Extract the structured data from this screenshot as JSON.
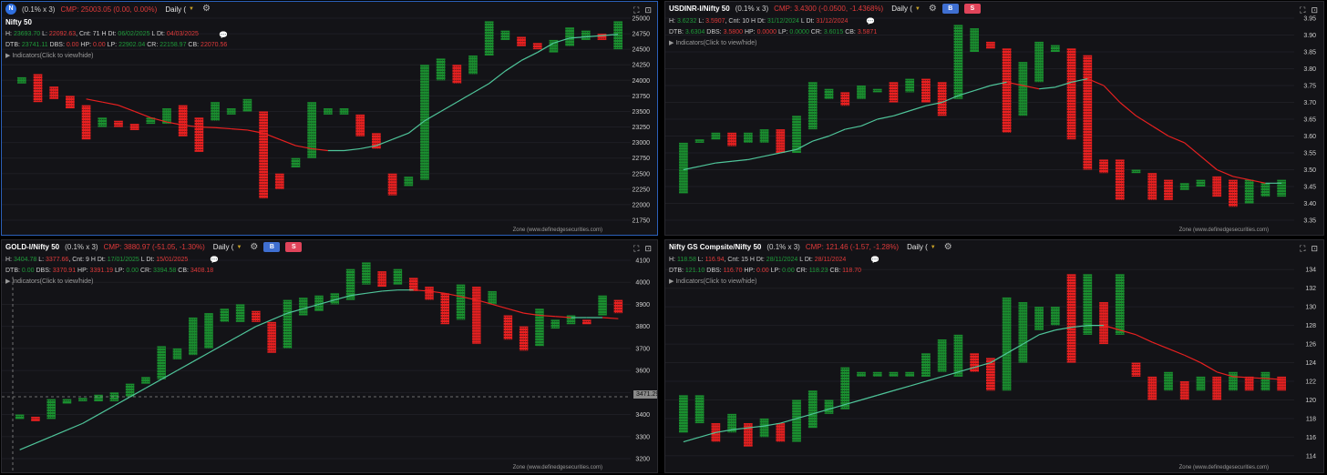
{
  "colors": {
    "bull": "#1a8f2f",
    "bear": "#e82020",
    "ma_up": "#4fc59a",
    "ma_down": "#e82020",
    "bg": "#131317",
    "grid": "#1e1e24",
    "axis_text": "#cfcfcf"
  },
  "panels": [
    {
      "header": {
        "badge": "N",
        "multiplier": "(0.1% x 3)",
        "cmp": "CMP: 25003.05 (0.00, 0.00%)",
        "timeframe": "Daily (",
        "settings_icon": "gear-icon"
      },
      "sub_title": "Nifty 50",
      "line1": {
        "h_label": "H:",
        "h_val": "23693.70",
        "l_label": "L:",
        "l_val": "22092.63",
        "cnt": ", Cnt: 71 H Dt:",
        "hdt": "06/02/2025",
        "ldt_label": "L Dt:",
        "ldt": "04/03/2025"
      },
      "line2": {
        "dtb_label": "DTB:",
        "dtb": "23741.11",
        "dbs_label": "DBS:",
        "dbs": "0.00",
        "hp_label": "HP:",
        "hp": "0.00",
        "lp_label": "LP:",
        "lp": "22902.04",
        "cr_label": "CR:",
        "cr": "22158.97",
        "cb_label": "CB:",
        "cb": "22070.56"
      },
      "indicators": "Indicators(Click to view/hide)",
      "zone": "Zone (www.definedgesecurities.com)"
    },
    {
      "header": {
        "title": "USDINR-I/Nifty 50",
        "multiplier": "(0.1% x 3)",
        "cmp": "CMP: 3.4300 (-0.0500, -1.4368%)",
        "timeframe": "Daily (",
        "buy": "B",
        "sell": "S"
      },
      "line1": {
        "h_label": "H:",
        "h_val": "3.6232",
        "l_label": "L:",
        "l_val": "3.5907",
        "cnt": ", Cnt: 10 H Dt:",
        "hdt": "31/12/2024",
        "ldt_label": "L Dt:",
        "ldt": "31/12/2024"
      },
      "line2": {
        "dtb_label": "DTB:",
        "dtb": "3.6304",
        "dbs_label": "DBS:",
        "dbs": "3.5800",
        "hp_label": "HP:",
        "hp": "0.0000",
        "lp_label": "LP:",
        "lp": "0.0000",
        "cr_label": "CR:",
        "cr": "3.6015",
        "cb_label": "CB:",
        "cb": "3.5871"
      },
      "indicators": "Indicators(Click to view/hide)",
      "zone": "Zone (www.definedgesecurities.com)"
    },
    {
      "header": {
        "title": "GOLD-I/Nifty 50",
        "multiplier": "(0.1% x 3)",
        "cmp": "CMP: 3880.97 (-51.05, -1.30%)",
        "timeframe": "Daily (",
        "buy": "B",
        "sell": "S"
      },
      "line1": {
        "h_label": "H:",
        "h_val": "3404.78",
        "l_label": "L:",
        "l_val": "3377.66",
        "cnt": ", Cnt: 9 H Dt:",
        "hdt": "17/01/2025",
        "ldt_label": "L Dt:",
        "ldt": "15/01/2025"
      },
      "line2": {
        "dtb_label": "DTB:",
        "dtb": "0.00",
        "dbs_label": "DBS:",
        "dbs": "3370.91",
        "hp_label": "HP:",
        "hp": "3391.19",
        "lp_label": "LP:",
        "lp": "0.00",
        "cr_label": "CR:",
        "cr": "3394.58",
        "cb_label": "CB:",
        "cb": "3408.18"
      },
      "indicators": "Indicators(Click to view/hide)",
      "zone": "Zone (www.definedgesecurities.com)",
      "cross_value": "3471.29"
    },
    {
      "header": {
        "title": "Nifty GS Compsite/Nifty 50",
        "multiplier": "(0.1% x 3)",
        "cmp": "CMP: 121.46 (-1.57, -1.28%)",
        "timeframe": "Daily ("
      },
      "line1": {
        "h_label": "H:",
        "h_val": "118.58",
        "l_label": "L:",
        "l_val": "116.94",
        "cnt": ", Cnt: 15 H Dt:",
        "hdt": "28/11/2024",
        "ldt_label": "L Dt:",
        "ldt": "28/11/2024"
      },
      "line2": {
        "dtb_label": "DTB:",
        "dtb": "121.10",
        "dbs_label": "DBS:",
        "dbs": "116.70",
        "hp_label": "HP:",
        "hp": "0.00",
        "lp_label": "LP:",
        "lp": "0.00",
        "cr_label": "CR:",
        "cr": "118.23",
        "cb_label": "CB:",
        "cb": "118.70"
      },
      "indicators": "Indicators(Click to view/hide)",
      "zone": "Zone (www.definedgesecurities.com)"
    }
  ],
  "chart_data": [
    {
      "type": "bar",
      "title": "Nifty 50",
      "ylim": [
        21750,
        25000
      ],
      "yticks": [
        21750,
        22000,
        22250,
        22500,
        22750,
        23000,
        23250,
        23500,
        23750,
        24000,
        24250,
        24500,
        24750,
        25000
      ],
      "bars": [
        [
          24050,
          23950
        ],
        [
          24100,
          23650
        ],
        [
          23900,
          23700
        ],
        [
          23750,
          23550
        ],
        [
          23600,
          23050
        ],
        [
          23400,
          23250
        ],
        [
          23350,
          23250
        ],
        [
          23300,
          23200
        ],
        [
          23400,
          23300
        ],
        [
          23550,
          23300
        ],
        [
          23600,
          23100
        ],
        [
          23400,
          22850
        ],
        [
          23650,
          23350
        ],
        [
          23550,
          23450
        ],
        [
          23700,
          23500
        ],
        [
          23500,
          22100
        ],
        [
          22500,
          22250
        ],
        [
          22750,
          22600
        ],
        [
          23650,
          22750
        ],
        [
          23550,
          23450
        ],
        [
          23550,
          23450
        ],
        [
          23450,
          23100
        ],
        [
          23150,
          22900
        ],
        [
          22500,
          22150
        ],
        [
          22450,
          22300
        ],
        [
          24250,
          22400
        ],
        [
          24350,
          24000
        ],
        [
          24250,
          23950
        ],
        [
          24400,
          24100
        ],
        [
          24950,
          24400
        ],
        [
          24800,
          24650
        ],
        [
          24700,
          24550
        ],
        [
          24600,
          24500
        ],
        [
          24650,
          24450
        ],
        [
          24850,
          24550
        ],
        [
          24800,
          24650
        ],
        [
          24750,
          24650
        ],
        [
          24950,
          24500
        ]
      ],
      "ma": [
        23700,
        23650,
        23600,
        23500,
        23400,
        23330,
        23280,
        23250,
        23240,
        23220,
        23200,
        23150,
        23050,
        22950,
        22900,
        22870,
        22870,
        22900,
        22950,
        23050,
        23150,
        23350,
        23500,
        23650,
        23800,
        23950,
        24150,
        24320,
        24450,
        24600,
        24680,
        24700,
        24720,
        24740
      ]
    },
    {
      "type": "bar",
      "title": "USDINR-I/Nifty 50",
      "ylim": [
        3.35,
        3.95
      ],
      "yticks": [
        3.35,
        3.4,
        3.45,
        3.5,
        3.55,
        3.6,
        3.65,
        3.7,
        3.75,
        3.8,
        3.85,
        3.9,
        3.95
      ],
      "bars": [
        [
          3.58,
          3.43
        ],
        [
          3.59,
          3.58
        ],
        [
          3.61,
          3.59
        ],
        [
          3.61,
          3.57
        ],
        [
          3.61,
          3.58
        ],
        [
          3.62,
          3.58
        ],
        [
          3.62,
          3.55
        ],
        [
          3.66,
          3.55
        ],
        [
          3.76,
          3.62
        ],
        [
          3.74,
          3.71
        ],
        [
          3.73,
          3.69
        ],
        [
          3.75,
          3.71
        ],
        [
          3.74,
          3.73
        ],
        [
          3.76,
          3.7
        ],
        [
          3.77,
          3.73
        ],
        [
          3.77,
          3.7
        ],
        [
          3.76,
          3.66
        ],
        [
          3.93,
          3.71
        ],
        [
          3.92,
          3.85
        ],
        [
          3.88,
          3.86
        ],
        [
          3.86,
          3.61
        ],
        [
          3.82,
          3.66
        ],
        [
          3.88,
          3.76
        ],
        [
          3.87,
          3.85
        ],
        [
          3.86,
          3.59
        ],
        [
          3.84,
          3.5
        ],
        [
          3.53,
          3.49
        ],
        [
          3.53,
          3.41
        ],
        [
          3.5,
          3.49
        ],
        [
          3.49,
          3.41
        ],
        [
          3.47,
          3.41
        ],
        [
          3.46,
          3.44
        ],
        [
          3.47,
          3.45
        ],
        [
          3.48,
          3.42
        ],
        [
          3.47,
          3.39
        ],
        [
          3.47,
          3.4
        ],
        [
          3.46,
          3.42
        ],
        [
          3.47,
          3.42
        ]
      ],
      "ma": [
        3.5,
        3.51,
        3.52,
        3.525,
        3.53,
        3.54,
        3.55,
        3.56,
        3.585,
        3.6,
        3.62,
        3.63,
        3.65,
        3.66,
        3.675,
        3.69,
        3.7,
        3.72,
        3.735,
        3.75,
        3.76,
        3.75,
        3.74,
        3.745,
        3.76,
        3.77,
        3.75,
        3.7,
        3.66,
        3.63,
        3.6,
        3.58,
        3.54,
        3.5,
        3.48,
        3.47,
        3.46,
        3.46
      ]
    },
    {
      "type": "bar",
      "title": "GOLD-I/Nifty 50",
      "ylim": [
        3200,
        4100
      ],
      "yticks": [
        3200,
        3300,
        3400,
        3500,
        3600,
        3700,
        3800,
        3900,
        4000,
        4100
      ],
      "bars": [
        [
          3400,
          3380
        ],
        [
          3390,
          3370
        ],
        [
          3470,
          3380
        ],
        [
          3470,
          3450
        ],
        [
          3475,
          3460
        ],
        [
          3490,
          3460
        ],
        [
          3500,
          3460
        ],
        [
          3540,
          3480
        ],
        [
          3570,
          3540
        ],
        [
          3710,
          3560
        ],
        [
          3700,
          3650
        ],
        [
          3840,
          3670
        ],
        [
          3860,
          3700
        ],
        [
          3880,
          3820
        ],
        [
          3900,
          3820
        ],
        [
          3870,
          3820
        ],
        [
          3820,
          3680
        ],
        [
          3920,
          3700
        ],
        [
          3930,
          3850
        ],
        [
          3940,
          3870
        ],
        [
          3950,
          3900
        ],
        [
          4060,
          3920
        ],
        [
          4090,
          3990
        ],
        [
          4050,
          3980
        ],
        [
          4060,
          3990
        ],
        [
          4020,
          3960
        ],
        [
          3980,
          3920
        ],
        [
          3950,
          3810
        ],
        [
          3990,
          3830
        ],
        [
          3980,
          3720
        ],
        [
          3960,
          3900
        ],
        [
          3850,
          3740
        ],
        [
          3800,
          3690
        ],
        [
          3880,
          3710
        ],
        [
          3830,
          3790
        ],
        [
          3850,
          3810
        ],
        [
          3830,
          3810
        ],
        [
          3940,
          3850
        ],
        [
          3920,
          3860
        ]
      ],
      "ma": [
        3240,
        3270,
        3300,
        3330,
        3360,
        3400,
        3440,
        3480,
        3520,
        3560,
        3600,
        3640,
        3680,
        3720,
        3760,
        3800,
        3830,
        3860,
        3880,
        3900,
        3920,
        3940,
        3950,
        3960,
        3965,
        3965,
        3960,
        3950,
        3935,
        3920,
        3900,
        3880,
        3860,
        3850,
        3845,
        3840,
        3840,
        3840,
        3835
      ]
    },
    {
      "type": "bar",
      "title": "Nifty GS Compsite/Nifty 50",
      "ylim": [
        113.5,
        135
      ],
      "yticks": [
        114,
        116,
        118,
        120,
        122,
        124,
        126,
        128,
        130,
        132,
        134
      ],
      "bars": [
        [
          120.5,
          116.5
        ],
        [
          120.5,
          117.5
        ],
        [
          117.5,
          115.5
        ],
        [
          118.5,
          116.5
        ],
        [
          117.5,
          115
        ],
        [
          118,
          116
        ],
        [
          117.5,
          115.5
        ],
        [
          120,
          115.5
        ],
        [
          121,
          117
        ],
        [
          120,
          118.5
        ],
        [
          123.5,
          119
        ],
        [
          123,
          122.5
        ],
        [
          123,
          122.5
        ],
        [
          123,
          122.5
        ],
        [
          123,
          122.5
        ],
        [
          125,
          122.5
        ],
        [
          126.5,
          123
        ],
        [
          127,
          122.5
        ],
        [
          125,
          123
        ],
        [
          124.5,
          121
        ],
        [
          131,
          121
        ],
        [
          130.5,
          124
        ],
        [
          130,
          127.5
        ],
        [
          130,
          128
        ],
        [
          133.5,
          124
        ],
        [
          133.5,
          127
        ],
        [
          130.5,
          126
        ],
        [
          133.5,
          127
        ],
        [
          124,
          122.5
        ],
        [
          122.5,
          120
        ],
        [
          123,
          121
        ],
        [
          122,
          120
        ],
        [
          122.5,
          121
        ],
        [
          122.5,
          120
        ],
        [
          123,
          121
        ],
        [
          122.5,
          121
        ],
        [
          123,
          121
        ],
        [
          122.5,
          121
        ]
      ],
      "ma": [
        115.5,
        116,
        116.5,
        116.8,
        117,
        117.2,
        117.5,
        118,
        118.5,
        119,
        119.5,
        120,
        120.5,
        121,
        121.5,
        122,
        122.5,
        123,
        123.5,
        124,
        125,
        126,
        127,
        127.5,
        127.8,
        128,
        128,
        127.5,
        127,
        126.2,
        125.5,
        124.8,
        124,
        123,
        122.5,
        122.4,
        122.3,
        122.2
      ]
    }
  ]
}
